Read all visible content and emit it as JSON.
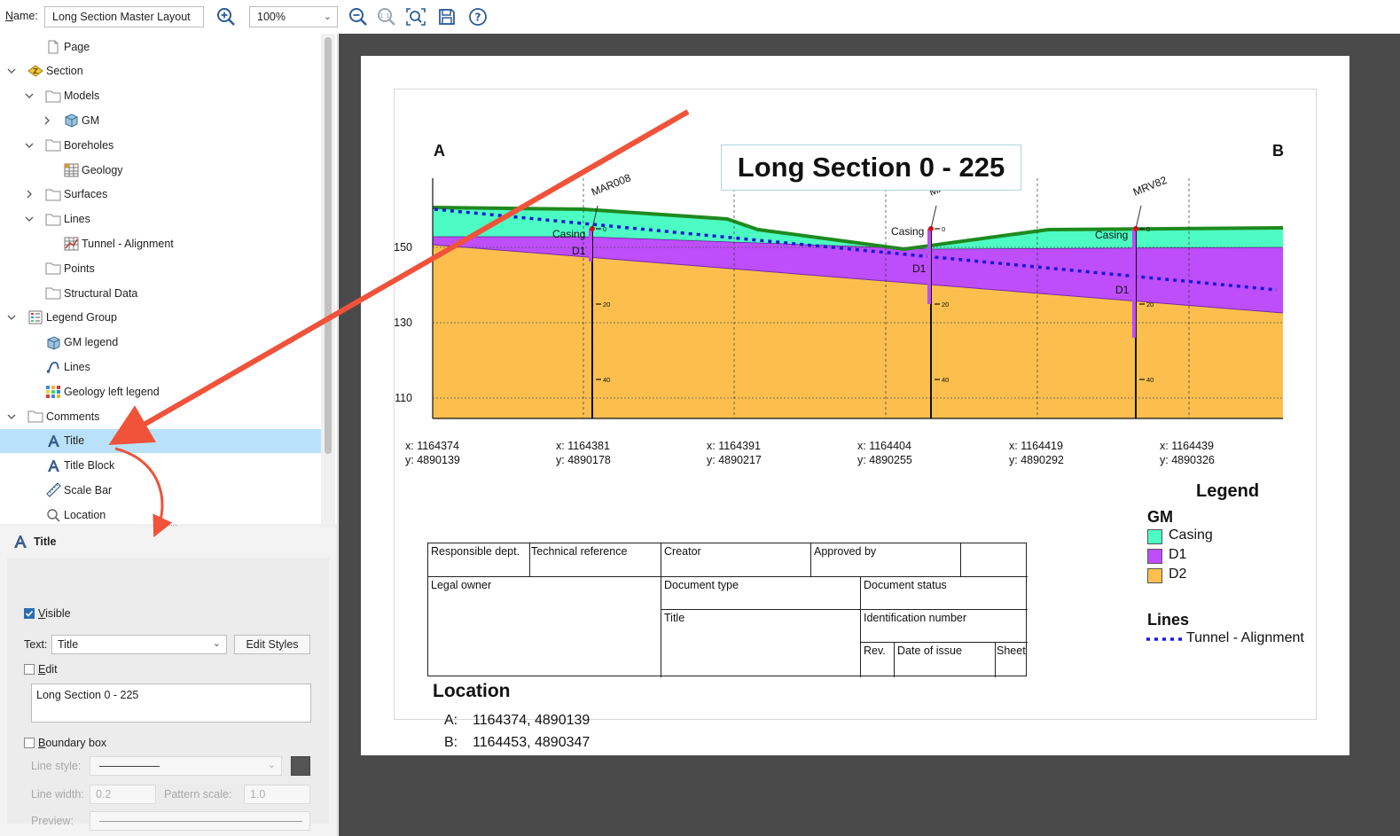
{
  "toolbar": {
    "name_label_accel": "N",
    "name_label_rest": "ame:",
    "name_value": "Long Section Master Layout",
    "zoom_value": "100%",
    "icons": [
      "zoom-in-icon",
      "zoom-out-icon",
      "zoom-actual-icon",
      "zoom-fit-icon",
      "save-icon",
      "help-icon"
    ]
  },
  "tree": {
    "items": [
      {
        "label": "Page",
        "icon": "page-icon"
      },
      {
        "label": "Section",
        "icon": "section-icon",
        "expanded": true
      },
      {
        "label": "Models",
        "icon": "folder-icon",
        "expanded": true
      },
      {
        "label": "GM",
        "icon": "geomodel-icon",
        "expanded": false
      },
      {
        "label": "Boreholes",
        "icon": "folder-icon",
        "expanded": true
      },
      {
        "label": "Geology",
        "icon": "table-icon"
      },
      {
        "label": "Surfaces",
        "icon": "folder-icon",
        "expanded": false
      },
      {
        "label": "Lines",
        "icon": "folder-icon",
        "expanded": true
      },
      {
        "label": "Tunnel - Alignment",
        "icon": "polyline-icon"
      },
      {
        "label": "Points",
        "icon": "folder-icon"
      },
      {
        "label": "Structural Data",
        "icon": "folder-icon"
      },
      {
        "label": "Legend Group",
        "icon": "legend-group-icon",
        "expanded": true
      },
      {
        "label": "GM legend",
        "icon": "geomodel-icon"
      },
      {
        "label": "Lines",
        "icon": "lines-legend-icon"
      },
      {
        "label": "Geology left legend",
        "icon": "color-legend-icon"
      },
      {
        "label": "Comments",
        "icon": "folder-icon",
        "expanded": true
      },
      {
        "label": "Title",
        "icon": "text-a-icon",
        "selected": true
      },
      {
        "label": "Title Block",
        "icon": "text-a-icon"
      },
      {
        "label": "Scale Bar",
        "icon": "ruler-icon"
      },
      {
        "label": "Location",
        "icon": "location-icon"
      }
    ]
  },
  "properties": {
    "header": "Title",
    "visible_label_accel": "V",
    "visible_label_rest": "isible",
    "visible_checked": true,
    "text_label": "Text:",
    "text_value": "Title",
    "edit_styles_label": "Edit Styles",
    "edit_label_accel": "E",
    "edit_label_rest": "dit",
    "edit_checked": false,
    "edit_text": "Long Section 0 - 225",
    "boundary_label_accel": "B",
    "boundary_label_rest": "oundary box",
    "boundary_checked": false,
    "line_style_label": "Line style:",
    "line_width_label": "Line width:",
    "line_width_value": "0.2",
    "pattern_scale_label": "Pattern scale:",
    "pattern_scale_value": "1.0",
    "preview_label": "Preview:"
  },
  "layout": {
    "title": "Long Section 0 - 225",
    "end_a": "A",
    "end_b": "B",
    "coordinates": [
      {
        "x": "x: 1164374",
        "y": "y: 4890139"
      },
      {
        "x": "x: 1164381",
        "y": "y: 4890178"
      },
      {
        "x": "x: 1164391",
        "y": "y: 4890217"
      },
      {
        "x": "x: 1164404",
        "y": "y: 4890255"
      },
      {
        "x": "x: 1164419",
        "y": "y: 4890292"
      },
      {
        "x": "x: 1164439",
        "y": "y: 4890326"
      }
    ],
    "legend": {
      "title": "Legend",
      "gm_heading": "GM",
      "gm_items": [
        {
          "label": "Casing",
          "color": "#4dfcc3"
        },
        {
          "label": "D1",
          "color": "#be4dfa"
        },
        {
          "label": "D2",
          "color": "#fcbf4e"
        }
      ],
      "lines_heading": "Lines",
      "line_item": "Tunnel - Alignment",
      "line_color": "#1a1ad6"
    },
    "title_block": {
      "responsible": "Responsible dept.",
      "technical": "Technical reference",
      "creator": "Creator",
      "approved": "Approved by",
      "legal": "Legal owner",
      "doc_type": "Document type",
      "doc_status": "Document status",
      "title": "Title",
      "ident": "Identification number",
      "rev": "Rev.",
      "date": "Date of issue",
      "sheet": "Sheet"
    },
    "location": {
      "heading": "Location",
      "a_label": "A:",
      "a_value": "1164374, 4890139",
      "b_label": "B:",
      "b_value": "1164453, 4890347"
    }
  },
  "chart_data": {
    "type": "area",
    "title": "",
    "ylabel": "",
    "y_ticks": [
      150,
      130,
      110
    ],
    "ylim": [
      105,
      172
    ],
    "colors": {
      "casing": "#4dfcc3",
      "d1": "#be4dfa",
      "d2": "#fcbf4e",
      "topo": "#1e8a1e",
      "tunnel": "#1a1ad6"
    },
    "boreholes": [
      {
        "name": "MAR008",
        "casing_label": "Casing",
        "d1_label": "D1",
        "depth_ticks": [
          "0",
          "20",
          "40"
        ]
      },
      {
        "name": "MAR009",
        "casing_label": "Casing",
        "d1_label": "D1",
        "depth_ticks": [
          "0",
          "20",
          "40"
        ]
      },
      {
        "name": "MRV82",
        "casing_label": "Casing",
        "d1_label": "D1",
        "depth_ticks": [
          "0",
          "20",
          "40"
        ]
      }
    ]
  }
}
